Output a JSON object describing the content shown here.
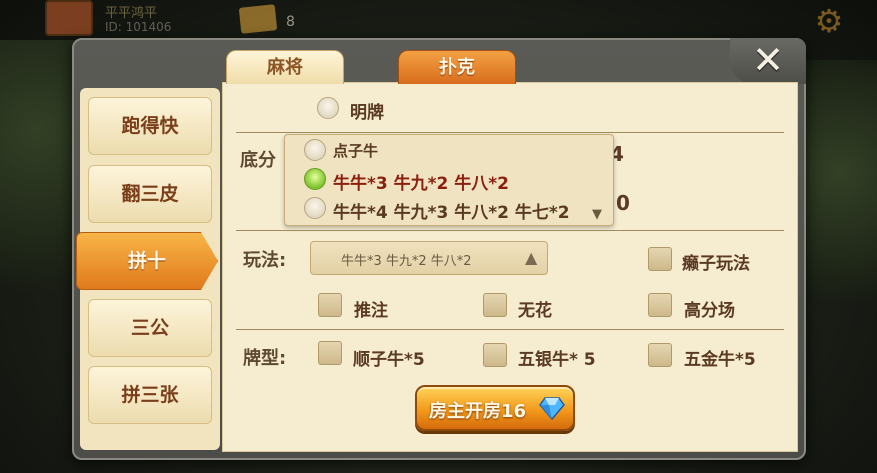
{
  "top_bar": {
    "player_name": "平平鸿平",
    "player_id": "ID: 101406",
    "card_count": "8"
  },
  "dialog": {
    "close_label": "✕",
    "tabs": [
      {
        "label": "麻将",
        "active": false
      },
      {
        "label": "扑克",
        "active": true
      }
    ],
    "side_tabs": [
      {
        "label": "跑得快",
        "active": false
      },
      {
        "label": "翻三皮",
        "active": false
      },
      {
        "label": "拼十",
        "active": true
      },
      {
        "label": "三公",
        "active": false
      },
      {
        "label": "拼三张",
        "active": false
      }
    ],
    "ming_pai": {
      "label": "明牌",
      "checked": false
    },
    "base_score": {
      "label": "底分",
      "behind_values": [
        "4",
        "0"
      ],
      "options": [
        {
          "label": "点子牛",
          "checked": false
        },
        {
          "label": "牛牛*3 牛九*2 牛八*2",
          "checked": true
        },
        {
          "label": "牛牛*4 牛九*3 牛八*2 牛七*2",
          "checked": false
        }
      ]
    },
    "play_mode": {
      "label": "玩法:",
      "selected": "牛牛*3 牛九*2 牛八*2",
      "options": [
        {
          "label": "癞子玩法",
          "checked": false
        },
        {
          "label": "推注",
          "checked": false
        },
        {
          "label": "无花",
          "checked": false
        },
        {
          "label": "高分场",
          "checked": false
        }
      ]
    },
    "card_type": {
      "label": "牌型:",
      "options": [
        {
          "label": "顺子牛*5",
          "checked": false
        },
        {
          "label": "五银牛* 5",
          "checked": false
        },
        {
          "label": "五金牛*5",
          "checked": false
        }
      ]
    },
    "create_button": {
      "label": "房主开房16"
    }
  }
}
